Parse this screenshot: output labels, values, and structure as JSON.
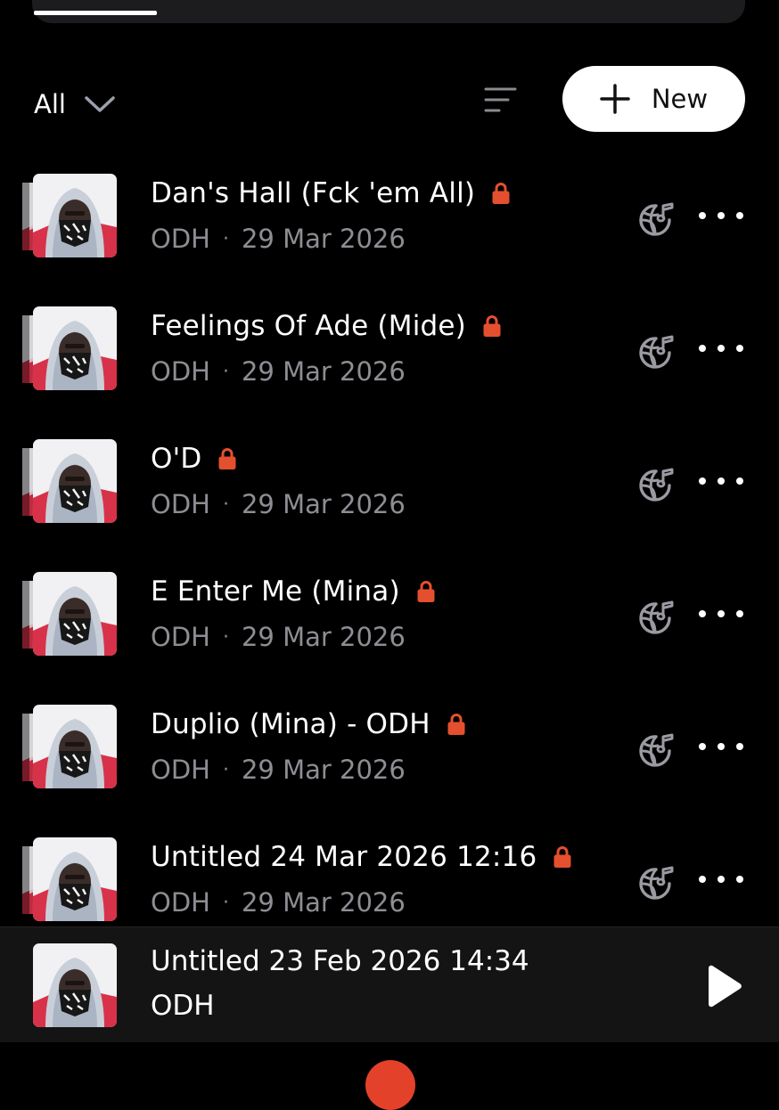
{
  "filter": {
    "label": "All",
    "icon": "chevron-down-icon"
  },
  "toolbar": {
    "sort_icon": "sort-icon",
    "new_label": "New",
    "new_icon": "plus-icon"
  },
  "colors": {
    "background": "#000000",
    "lock": "#e4502f",
    "subtext": "#8d8d93",
    "icon_grey": "#9a9aa2",
    "accent": "#e4412b"
  },
  "tracks": [
    {
      "title": "Dan's Hall (Fck 'em All)",
      "artist": "ODH",
      "separator": "·",
      "date": "29 Mar 2026",
      "locked": true
    },
    {
      "title": "Feelings Of Ade (Mide)",
      "artist": "ODH",
      "separator": "·",
      "date": "29 Mar 2026",
      "locked": true
    },
    {
      "title": "O'D",
      "artist": "ODH",
      "separator": "·",
      "date": "29 Mar 2026",
      "locked": true
    },
    {
      "title": "E Enter Me (Mina)",
      "artist": "ODH",
      "separator": "·",
      "date": "29 Mar 2026",
      "locked": true
    },
    {
      "title": "Duplio (Mina) - ODH",
      "artist": "ODH",
      "separator": "·",
      "date": "29 Mar 2026",
      "locked": true
    },
    {
      "title": "Untitled 24 Mar 2026 12:16",
      "artist": "ODH",
      "separator": "·",
      "date": "29 Mar 2026",
      "locked": true
    }
  ],
  "player": {
    "title": "Untitled 23 Feb 2026 14:34",
    "artist": "ODH",
    "icon": "play-icon"
  }
}
